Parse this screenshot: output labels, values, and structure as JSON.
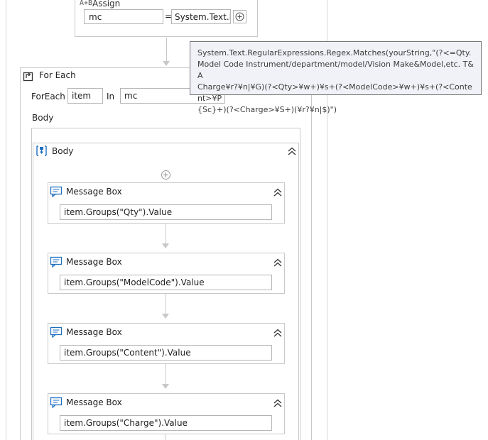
{
  "assign": {
    "title": "Assign",
    "to_value": "mc",
    "equals": "=",
    "value_text": "System.Text.Re"
  },
  "tooltip": {
    "text": "System.Text.RegularExpressions.Regex.Matches(yourString,\"(?<=Qty.\nModel Code Instrument/department/model/Vision Make&Model,etc. T&A\nCharge¥r?¥n|¥G)(?<Qty>¥w+)¥s+(?<ModelCode>¥w+)¥s+(?<Content>¥P\n{Sc}+)(?<Charge>¥S+)(¥r?¥n|$)\")"
  },
  "foreach": {
    "title": "For Each",
    "foreach_label": "ForEach",
    "item_value": "item",
    "in_label": "In",
    "in_value": "mc",
    "body_label": "Body"
  },
  "sequence": {
    "title": "Body"
  },
  "message_boxes": [
    {
      "title": "Message Box",
      "expression": "item.Groups(\"Qty\").Value"
    },
    {
      "title": "Message Box",
      "expression": "item.Groups(\"ModelCode\").Value"
    },
    {
      "title": "Message Box",
      "expression": "item.Groups(\"Content\").Value"
    },
    {
      "title": "Message Box",
      "expression": "item.Groups(\"Charge\").Value"
    }
  ],
  "colors": {
    "border": "#c9c9c9",
    "tooltip_bg": "#f1f2f7",
    "icon_blue": "#1e6fc0"
  }
}
